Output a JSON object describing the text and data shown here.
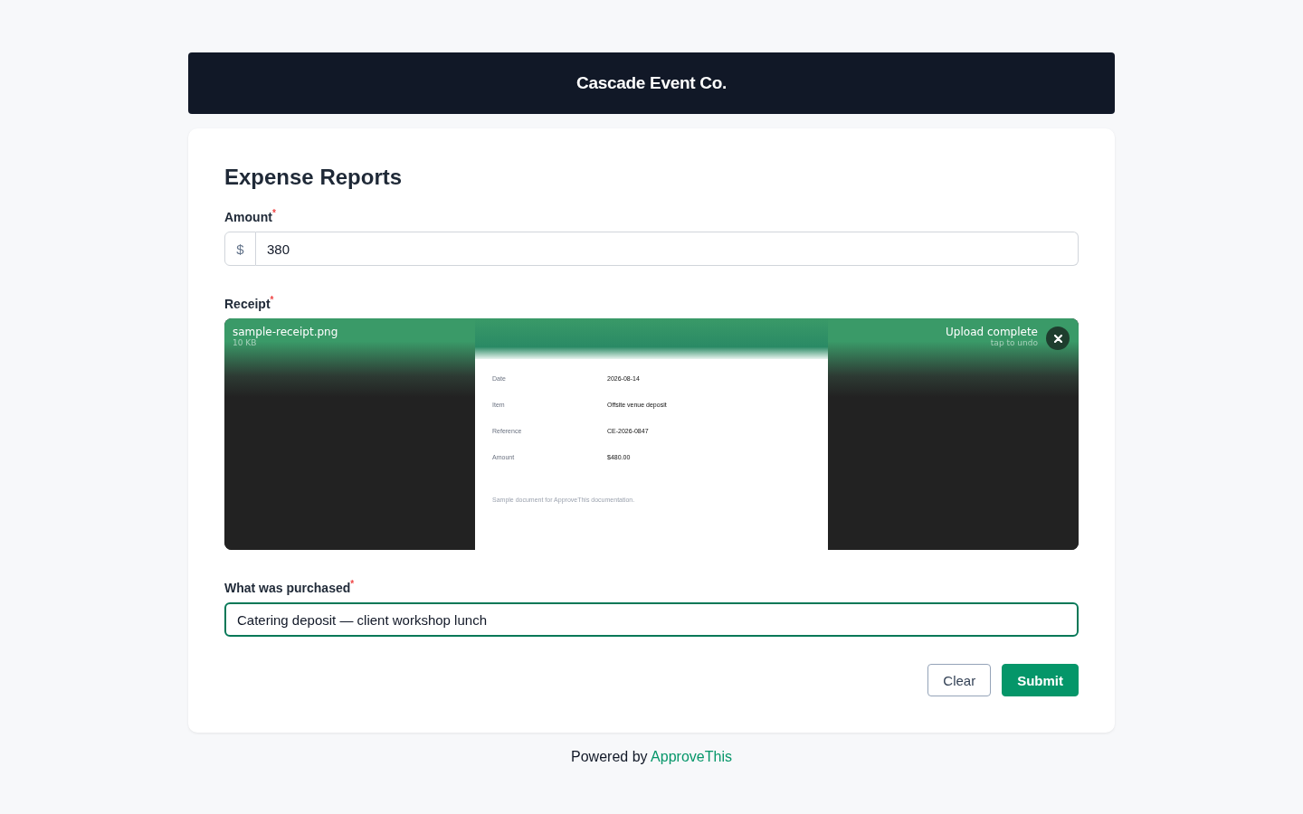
{
  "header": {
    "title": "Cascade Event Co."
  },
  "form": {
    "title": "Expense Reports",
    "fields": [
      {
        "kind": "amount",
        "label": "Amount",
        "required_mark": "*",
        "prefix": "$",
        "value": "380"
      },
      {
        "kind": "upload",
        "label": "Receipt",
        "required_mark": "*",
        "file_name": "sample-receipt.png",
        "file_size": "10 KB",
        "status": "Upload complete",
        "status_hint": "tap to undo",
        "document": {
          "rows": [
            {
              "label": "Date",
              "value": "2026-08-14"
            },
            {
              "label": "Item",
              "value": "Offsite venue deposit"
            },
            {
              "label": "Reference",
              "value": "CE-2026-0847"
            },
            {
              "label": "Amount",
              "value": "$480.00"
            }
          ],
          "note": "Sample document for ApproveThis documentation."
        }
      },
      {
        "kind": "text",
        "label": "What was purchased",
        "required_mark": "*",
        "value": "Catering deposit — client workshop lunch",
        "focused": true
      }
    ],
    "buttons": [
      {
        "label": "Clear",
        "kind": "secondary"
      },
      {
        "label": "Submit",
        "kind": "primary"
      }
    ]
  },
  "footer": {
    "text": "Powered by",
    "link": "ApproveThis"
  }
}
